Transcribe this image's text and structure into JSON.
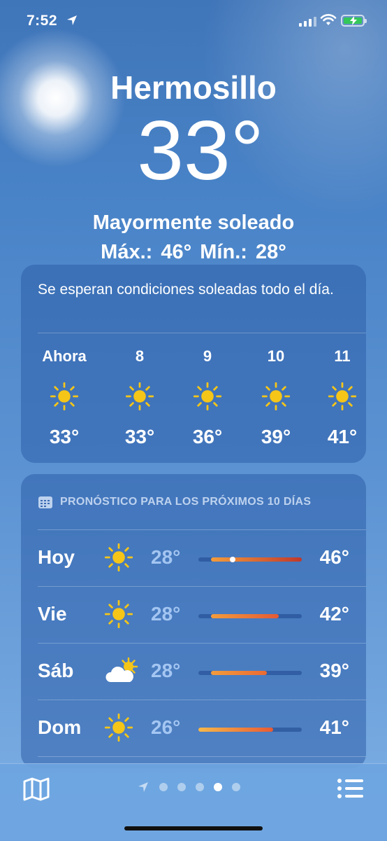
{
  "status": {
    "time": "7:52"
  },
  "header": {
    "city": "Hermosillo",
    "temperature": "33°",
    "condition": "Mayormente soleado",
    "high_low": "Máx.: 46°  Mín.: 28°"
  },
  "hourly": {
    "summary": "Se esperan condiciones soleadas todo el día.",
    "items": [
      {
        "label": "Ahora",
        "icon": "sun-icon",
        "temp": "33°"
      },
      {
        "label": "8",
        "icon": "sun-icon",
        "temp": "33°"
      },
      {
        "label": "9",
        "icon": "sun-icon",
        "temp": "36°"
      },
      {
        "label": "10",
        "icon": "sun-icon",
        "temp": "39°"
      },
      {
        "label": "11",
        "icon": "sun-icon",
        "temp": "41°"
      }
    ]
  },
  "daily": {
    "header": "PRONÓSTICO PARA LOS PRÓXIMOS 10 DÍAS",
    "rows": [
      {
        "day": "Hoy",
        "icon": "sun-icon",
        "low": "28°",
        "high": "46°",
        "range_start": 0.12,
        "range_end": 1.0,
        "current": 0.33,
        "bar_colors": [
          "#f39c3c",
          "#c0392b"
        ]
      },
      {
        "day": "Vie",
        "icon": "sun-icon",
        "low": "28°",
        "high": "42°",
        "range_start": 0.12,
        "range_end": 0.78,
        "bar_colors": [
          "#f39c3c",
          "#e45a35"
        ]
      },
      {
        "day": "Sáb",
        "icon": "partly-cloudy-icon",
        "low": "28°",
        "high": "39°",
        "range_start": 0.12,
        "range_end": 0.66,
        "bar_colors": [
          "#f39c3c",
          "#ea6a33"
        ]
      },
      {
        "day": "Dom",
        "icon": "sun-icon",
        "low": "26°",
        "high": "41°",
        "range_start": 0.0,
        "range_end": 0.72,
        "bar_colors": [
          "#f7b84a",
          "#e95b33"
        ]
      }
    ]
  },
  "bottom_bar": {
    "map_icon": "map-icon",
    "list_icon": "list-icon",
    "pages": 4,
    "active_page": 3
  }
}
